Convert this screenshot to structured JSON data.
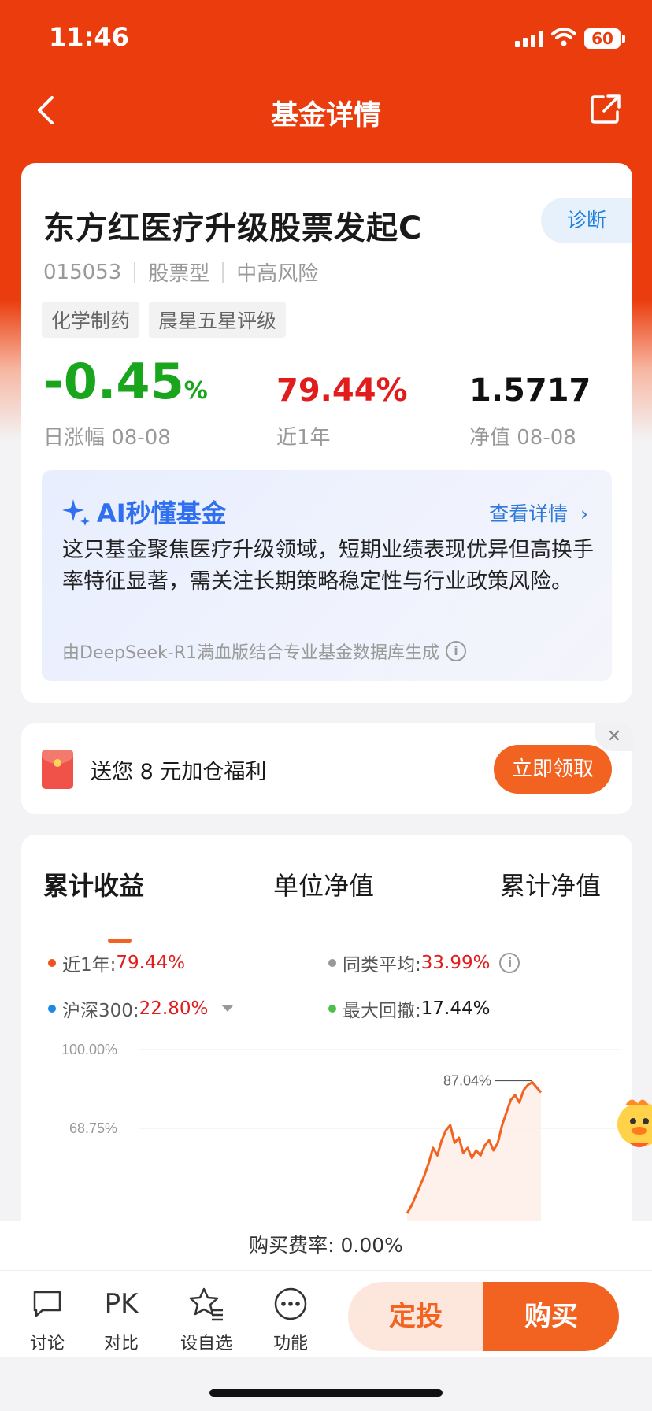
{
  "status": {
    "time": "11:46",
    "battery": "60"
  },
  "nav": {
    "title": "基金详情"
  },
  "fund": {
    "name": "东方红医疗升级股票发起C",
    "diagnose_label": "诊断",
    "code": "015053",
    "type": "股票型",
    "risk": "中高风险",
    "tags": [
      "化学制药",
      "晨星五星评级"
    ],
    "day_change": "-0.45",
    "day_change_unit": "%",
    "day_change_label": "日涨幅 08-08",
    "year_return": "79.44%",
    "year_return_label": "近1年",
    "nav_value": "1.5717",
    "nav_label": "净值 08-08"
  },
  "ai": {
    "title": "AI秒懂基金",
    "more": "查看详情",
    "summary": "这只基金聚焦医疗升级领域，短期业绩表现优异但高换手率特征显著，需关注长期策略稳定性与行业政策风险。",
    "footer": "由DeepSeek-R1满血版结合专业基金数据库生成"
  },
  "promo": {
    "text": "送您 8 元加仓福利",
    "button": "立即领取",
    "close": "✕"
  },
  "performance": {
    "tabs": [
      "累计收益",
      "单位净值",
      "累计净值"
    ],
    "legend": [
      {
        "label": "近1年:",
        "value": "79.44%",
        "color": "#f2501e"
      },
      {
        "label": "同类平均:",
        "value": "33.99%",
        "color": "#999999"
      },
      {
        "label": "沪深300:",
        "value": "22.80%",
        "color": "#1e88e5"
      },
      {
        "label": "最大回撤:",
        "value": "17.44%",
        "color": "#4cbf4c"
      }
    ]
  },
  "chart_data": {
    "type": "line",
    "y_tick_labels": [
      "100.00%",
      "68.75%"
    ],
    "peak_label": "87.04%",
    "series": [
      {
        "name": "近1年",
        "color": "#f26322",
        "x": [
          0,
          1,
          2,
          3,
          4,
          5,
          6,
          7,
          8,
          9,
          10,
          11,
          12,
          13,
          14,
          15,
          16,
          17,
          18,
          19,
          20,
          21,
          22,
          23,
          24,
          25,
          26,
          27,
          28,
          29,
          30,
          31
        ],
        "values": [
          35,
          38,
          42,
          46,
          50,
          55,
          61,
          58,
          64,
          68,
          70,
          63,
          65,
          59,
          61,
          57,
          60,
          58,
          62,
          64,
          60,
          63,
          70,
          75,
          80,
          82,
          79,
          84,
          86,
          87.04,
          85,
          83
        ]
      }
    ]
  },
  "fee": {
    "text": "购买费率:  0.00%"
  },
  "bottom": {
    "actions": [
      "讨论",
      "对比",
      "设自选",
      "功能"
    ],
    "pk": "PK",
    "sip_button": "定投",
    "buy_button": "购买"
  }
}
